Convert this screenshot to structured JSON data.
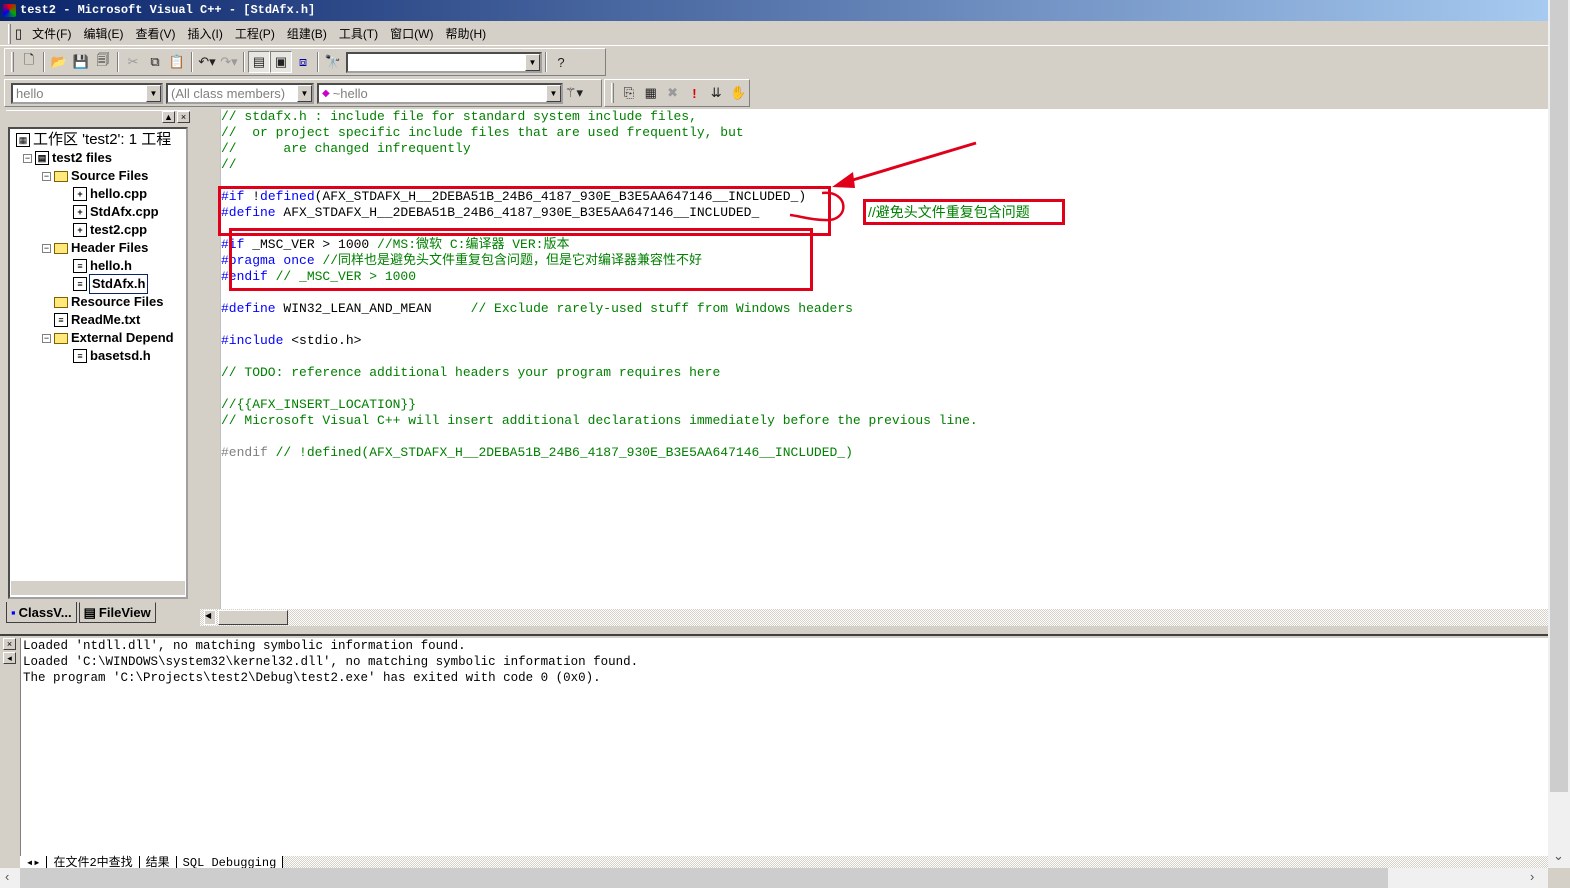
{
  "window": {
    "title": "test2 - Microsoft Visual C++ - [StdAfx.h]"
  },
  "menu": [
    "文件(F)",
    "编辑(E)",
    "查看(V)",
    "插入(I)",
    "工程(P)",
    "组建(B)",
    "工具(T)",
    "窗口(W)",
    "帮助(H)"
  ],
  "toolbar": {
    "find_combo_value": ""
  },
  "wizardbar": {
    "class_combo": "hello",
    "filter_combo": "(All class members)",
    "member_combo": "~hello"
  },
  "workspace": {
    "tree": [
      {
        "label": "工作区 'test2': 1 工程",
        "depth": 0,
        "icon": "workspace-icon"
      },
      {
        "label": "test2 files",
        "depth": 1,
        "icon": "project-icon",
        "expanded": true
      },
      {
        "label": "Source Files",
        "depth": 2,
        "icon": "folder-icon",
        "expanded": true
      },
      {
        "label": "hello.cpp",
        "depth": 3,
        "icon": "cpp-file-icon"
      },
      {
        "label": "StdAfx.cpp",
        "depth": 3,
        "icon": "cpp-file-icon"
      },
      {
        "label": "test2.cpp",
        "depth": 3,
        "icon": "cpp-file-icon"
      },
      {
        "label": "Header Files",
        "depth": 2,
        "icon": "folder-icon",
        "expanded": true
      },
      {
        "label": "hello.h",
        "depth": 3,
        "icon": "header-file-icon"
      },
      {
        "label": "StdAfx.h",
        "depth": 3,
        "icon": "header-file-icon",
        "selected": true
      },
      {
        "label": "Resource Files",
        "depth": 2,
        "icon": "folder-icon"
      },
      {
        "label": "ReadMe.txt",
        "depth": 2,
        "icon": "text-file-icon"
      },
      {
        "label": "External Depend",
        "depth": 2,
        "icon": "folder-icon",
        "expanded": true
      },
      {
        "label": "basetsd.h",
        "depth": 3,
        "icon": "header-file-icon"
      }
    ],
    "tabs": [
      "ClassV...",
      "FileView"
    ]
  },
  "code": [
    [
      [
        "cm",
        "// stdafx.h : include file for standard system include files,"
      ]
    ],
    [
      [
        "cm",
        "//  or project specific include files that are used frequently, but"
      ]
    ],
    [
      [
        "cm",
        "//      are changed infrequently"
      ]
    ],
    [
      [
        "cm",
        "//"
      ]
    ],
    [],
    [
      [
        "kw",
        "#if "
      ],
      [
        "tx",
        "!"
      ],
      [
        "kw",
        "defined"
      ],
      [
        "tx",
        "(AFX_STDAFX_H__2DEBA51B_24B6_4187_930E_B3E5AA647146__INCLUDED_)"
      ]
    ],
    [
      [
        "kw",
        "#define"
      ],
      [
        "tx",
        " AFX_STDAFX_H__2DEBA51B_24B6_4187_930E_B3E5AA647146__INCLUDED_"
      ]
    ],
    [],
    [
      [
        "kw",
        "#if"
      ],
      [
        "tx",
        " _MSC_VER > 1000 "
      ],
      [
        "cm",
        "//MS:微软 C:编译器 VER:版本"
      ]
    ],
    [
      [
        "kw",
        "#pragma once"
      ],
      [
        "tx",
        " "
      ],
      [
        "cm",
        "//同样也是避免头文件重复包含问题，但是它对编译器兼容性不好"
      ]
    ],
    [
      [
        "kw",
        "#endif"
      ],
      [
        "cm",
        " // _MSC_VER > 1000"
      ]
    ],
    [],
    [
      [
        "kw",
        "#define"
      ],
      [
        "tx",
        " WIN32_LEAN_AND_MEAN     "
      ],
      [
        "cm",
        "// Exclude rarely-used stuff from Windows headers"
      ]
    ],
    [],
    [
      [
        "kw",
        "#include"
      ],
      [
        "tx",
        " <stdio.h>"
      ]
    ],
    [],
    [
      [
        "cm",
        "// TODO: reference additional headers your program requires here"
      ]
    ],
    [],
    [
      [
        "cm",
        "//{{AFX_INSERT_LOCATION}}"
      ]
    ],
    [
      [
        "cm",
        "// Microsoft Visual C++ will insert additional declarations immediately before the previous line."
      ]
    ],
    [],
    [
      [
        "gr",
        "#endif"
      ],
      [
        "cm",
        " // !defined(AFX_STDAFX_H__2DEBA51B_24B6_4187_930E_B3E5AA647146__INCLUDED_)"
      ]
    ]
  ],
  "annotation": {
    "note": "//避免头文件重复包含问题",
    "color": "#e0001a"
  },
  "output": {
    "lines": [
      "Loaded 'ntdll.dll', no matching symbolic information found.",
      "Loaded 'C:\\WINDOWS\\system32\\kernel32.dll', no matching symbolic information found.",
      "The program 'C:\\Projects\\test2\\Debug\\test2.exe' has exited with code 0 (0x0)."
    ],
    "tabs": [
      "在文件2中查找",
      "结果",
      "SQL Debugging"
    ]
  }
}
